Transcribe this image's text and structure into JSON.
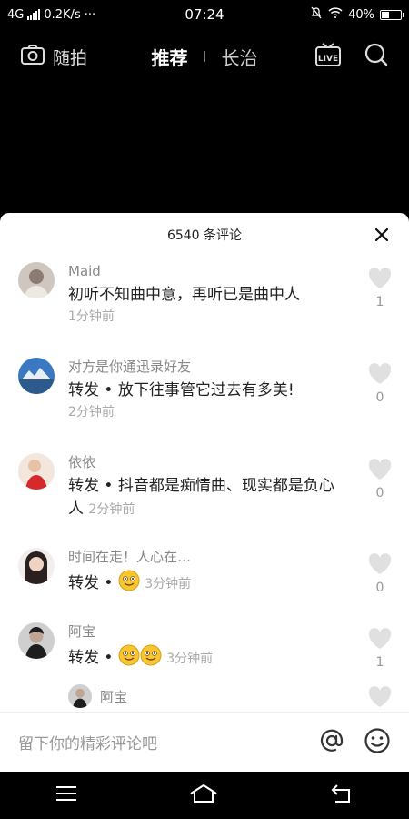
{
  "status": {
    "network": "4G",
    "speed": "0.2K/s",
    "more": "···",
    "time": "07:24",
    "battery": "40%",
    "battery_level": 0.4
  },
  "topnav": {
    "snap_label": "随拍",
    "tab_active": "推荐",
    "tab_city": "长治",
    "live_label": "LIVE"
  },
  "sheet": {
    "title": "6540 条评论"
  },
  "comments": [
    {
      "name": "Maid",
      "text": "初听不知曲中意，再听已是曲中人",
      "time": "1分钟前",
      "likes": "1"
    },
    {
      "name": "对方是你通迅录好友",
      "text": "转发 • 放下往事管它过去有多美!",
      "time": "2分钟前",
      "likes": "0"
    },
    {
      "name": "依依",
      "text": "转发 • 抖音都是痴情曲、现实都是负心人",
      "time": "2分钟前",
      "likes": "0"
    },
    {
      "name": "时间在走！人心在…",
      "text": "转发 •",
      "time": "3分钟前",
      "likes": "0"
    },
    {
      "name": "阿宝",
      "text": "转发 •",
      "time": "3分钟前",
      "likes": "1"
    }
  ],
  "reply": {
    "name": "阿宝"
  },
  "input": {
    "placeholder": "留下你的精彩评论吧"
  }
}
